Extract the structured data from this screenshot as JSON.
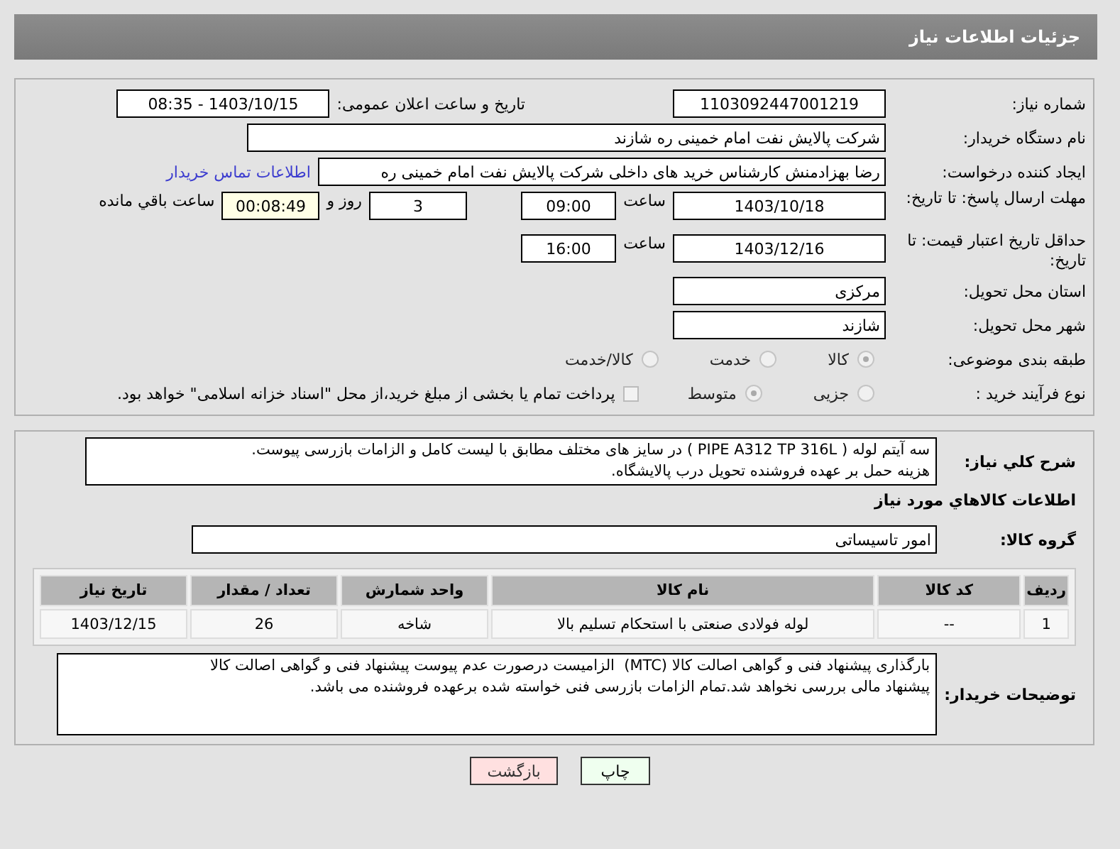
{
  "header": {
    "title": "جزئیات اطلاعات نیاز"
  },
  "need_info": {
    "need_number": {
      "label": "شماره نیاز:",
      "value": "1103092447001219"
    },
    "announce": {
      "label": "تاریخ و ساعت اعلان عمومی:",
      "value": "1403/10/15 - 08:35"
    },
    "buyer": {
      "label": "نام دستگاه خریدار:",
      "value": "شرکت پالایش نفت امام خمینی  ره  شازند"
    },
    "creator": {
      "label": "ایجاد کننده درخواست:",
      "value": "رضا بهزادمنش کارشناس خرید های داخلی  شرکت پالایش نفت امام خمینی  ره",
      "link": "اطلاعات تماس خریدار"
    },
    "deadline": {
      "label": "مهلت ارسال پاسخ: تا تاریخ:",
      "date": "1403/10/18",
      "time_label": "ساعت",
      "time": "09:00",
      "days": "3",
      "days_label": "روز و",
      "remaining": "00:08:49",
      "remaining_label": "ساعت باقي مانده"
    },
    "validity": {
      "label": "حداقل تاریخ اعتبار قیمت: تا تاریخ:",
      "date": "1403/12/16",
      "time_label": "ساعت",
      "time": "16:00"
    },
    "province": {
      "label": "استان محل تحویل:",
      "value": "مرکزی"
    },
    "city": {
      "label": "شهر محل تحویل:",
      "value": "شازند"
    },
    "category": {
      "label": "طبقه بندی موضوعی:",
      "options": [
        {
          "label": "کالا",
          "selected": true,
          "disabled": true
        },
        {
          "label": "خدمت",
          "selected": false,
          "disabled": true
        },
        {
          "label": "کالا/خدمت",
          "selected": false,
          "disabled": true
        }
      ]
    },
    "process": {
      "label": "نوع فرآیند خرید :",
      "options": [
        {
          "label": "جزیی",
          "selected": false,
          "disabled": true
        },
        {
          "label": "متوسط",
          "selected": true,
          "disabled": true
        }
      ],
      "payment": {
        "checked": false,
        "text": "پرداخت تمام یا بخشی از مبلغ خرید،از محل \"اسناد خزانه اسلامی\" خواهد بود."
      }
    }
  },
  "goods": {
    "description": {
      "label": "شرح کلي نياز:",
      "value": "سه آیتم لوله ( PIPE A312 TP 316L ) در سایز های مختلف مطابق با لیست کامل و الزامات بازرسی پیوست.\nهزینه حمل بر عهده فروشنده تحویل درب پالایشگاه."
    },
    "heading": "اطلاعات کالاهاي مورد نياز",
    "group": {
      "label": "گروه کالا:",
      "value": "امور تاسیساتی"
    },
    "table": {
      "columns": [
        "ردیف",
        "کد کالا",
        "نام کالا",
        "واحد شمارش",
        "تعداد / مقدار",
        "تاریخ نیاز"
      ],
      "rows": [
        [
          "1",
          "--",
          "لوله فولادی صنعتی با استحکام تسلیم بالا",
          "شاخه",
          "26",
          "1403/12/15"
        ]
      ]
    },
    "notes": {
      "label": "توضیحات خریدار:",
      "value": "بارگذاری پیشنهاد فنی و گواهی اصالت کالا (MTC)  الزامیست درصورت عدم پیوست پیشنهاد فنی و گواهی اصالت کالا\nپیشنهاد مالی بررسی نخواهد شد.تمام الزامات بازرسی فنی خواسته شده برعهده فروشنده می باشد."
    }
  },
  "buttons": [
    {
      "kind": "print",
      "label": "چاپ"
    },
    {
      "kind": "back",
      "label": "بازگشت"
    }
  ]
}
